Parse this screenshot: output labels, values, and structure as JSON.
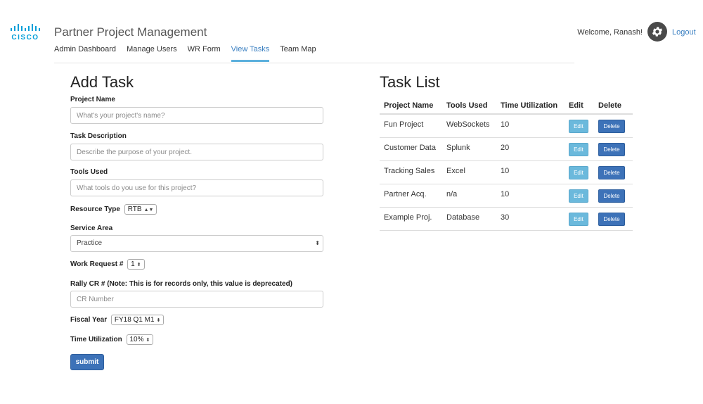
{
  "header": {
    "logo_text": "CISCO",
    "app_title": "Partner Project Management",
    "nav": [
      {
        "label": "Admin Dashboard",
        "active": false
      },
      {
        "label": "Manage Users",
        "active": false
      },
      {
        "label": "WR Form",
        "active": false
      },
      {
        "label": "View Tasks",
        "active": true
      },
      {
        "label": "Team Map",
        "active": false
      }
    ],
    "welcome": "Welcome, Ranash!",
    "settings_icon": "gear-icon",
    "logout": "Logout"
  },
  "form": {
    "title": "Add Task",
    "project_name_label": "Project Name",
    "project_name_placeholder": "What's your project's name?",
    "task_description_label": "Task Description",
    "task_description_placeholder": "Describe the purpose of your project.",
    "tools_used_label": "Tools Used",
    "tools_used_placeholder": "What tools do you use for this project?",
    "resource_type_label": "Resource Type",
    "resource_type_value": "RTB",
    "service_area_label": "Service Area",
    "service_area_value": "Practice",
    "work_request_label": "Work Request #",
    "work_request_value": "1",
    "rally_label": "Rally CR # (Note: This is for records only, this value is deprecated)",
    "rally_placeholder": "CR Number",
    "fiscal_year_label": "Fiscal Year",
    "fiscal_year_value": "FY18 Q1 M1",
    "time_utilization_label": "Time Utilization",
    "time_utilization_value": "10%",
    "submit_label": "submit"
  },
  "task_list": {
    "title": "Task List",
    "columns": [
      "Project Name",
      "Tools Used",
      "Time Utilization",
      "Edit",
      "Delete"
    ],
    "edit_label": "Edit",
    "delete_label": "Delete",
    "rows": [
      {
        "project": "Fun Project",
        "tools": "WebSockets",
        "time": "10"
      },
      {
        "project": "Customer Data",
        "tools": "Splunk",
        "time": "20"
      },
      {
        "project": "Tracking Sales",
        "tools": "Excel",
        "time": "10"
      },
      {
        "project": "Partner Acq.",
        "tools": "n/a",
        "time": "10"
      },
      {
        "project": "Example Proj.",
        "tools": "Database",
        "time": "30"
      }
    ]
  },
  "colors": {
    "brand_blue": "#049fd9",
    "link_blue": "#3a7fc1",
    "primary_button": "#3d72b8",
    "info_button": "#6bb9dc"
  }
}
